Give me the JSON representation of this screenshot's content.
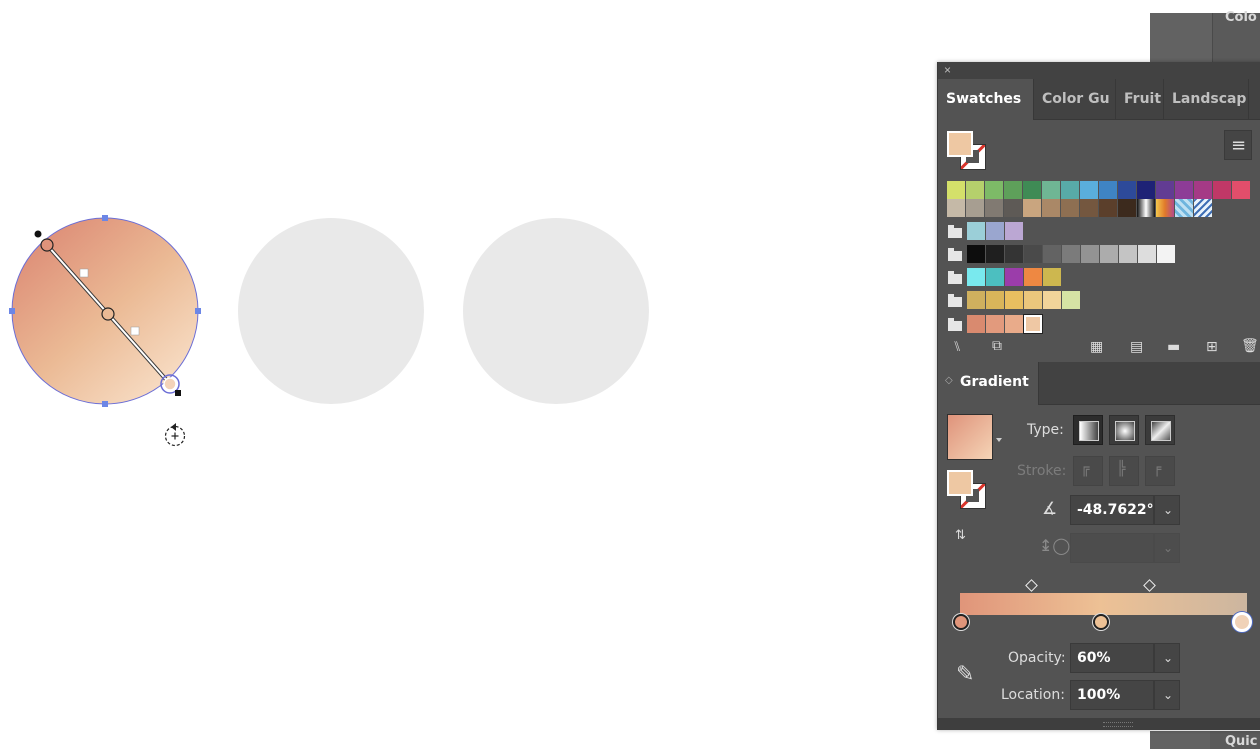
{
  "panels": {
    "color_label": "Colo",
    "quick_label": "Quic"
  },
  "swatches_panel": {
    "close_glyph": "×",
    "tabs": [
      {
        "label": "Swatches",
        "active": true
      },
      {
        "label": "Color Gu",
        "active": false
      },
      {
        "label": "Fruit",
        "active": false
      },
      {
        "label": "Landscap",
        "active": false
      }
    ],
    "menu_glyph": "≡",
    "rows": [
      [
        "#d4e06a",
        "#b5d06c",
        "#7dba67",
        "#5ea05a",
        "#3f8b55",
        "#6fb694",
        "#58aaa8",
        "#5aaedc",
        "#3f84c4",
        "#2d4a9a",
        "#1e2276",
        "#623c93",
        "#8d3c97",
        "#a53a86",
        "#c03867",
        "#e24e6b"
      ],
      [
        "#c5b9a7",
        "#a79e91",
        "#817a72",
        "#5e5a56",
        "#c9a57f",
        "#aa8867",
        "#8e6f52",
        "#74573f",
        "#5b3f2b",
        "#3c2a1d",
        "gradient-bw",
        "gradient-orange",
        "pattern-blue",
        "pattern-blue2"
      ],
      [
        "#9bcfd8",
        "#9aa6cf",
        "#bba7d3"
      ],
      [
        "#0d0d0d",
        "#1f1f1f",
        "#343434",
        "#4a4a4a",
        "#636363",
        "#7b7b7b",
        "#939393",
        "#acacac",
        "#c4c4c4",
        "#dddddd",
        "#f3f3f3"
      ],
      [
        "#79e9ee",
        "#4cbfc0",
        "#9b3daa",
        "#ee8842",
        "#cdb74f"
      ],
      [
        "#cfb05e",
        "#d9b55a",
        "#e8bf60",
        "#ebc77c",
        "#f2d49a",
        "#d6e3a4"
      ],
      [
        "#d98a6f",
        "#e29a7d",
        "#e9ab8a",
        "#efc8a4"
      ]
    ],
    "bottom_icons": [
      "library-menu-icon",
      "place-swatch-icon",
      "show-kinds-icon",
      "swatch-options-icon",
      "new-group-icon",
      "new-swatch-icon",
      "delete-icon"
    ]
  },
  "gradient_panel": {
    "title": "Gradient",
    "type_label": "Type:",
    "stroke_label": "Stroke:",
    "angle_value": "-48.7622°",
    "opacity_label": "Opacity:",
    "opacity_value": "60%",
    "location_label": "Location:",
    "location_value": "100%",
    "gradient_stops": [
      {
        "location": 0,
        "color": "#e0957a"
      },
      {
        "location": 49,
        "color": "#edc195"
      },
      {
        "location": 100,
        "color": "#f5d7b9"
      }
    ]
  },
  "canvas": {
    "colors": {
      "gradient_start": "#df937b",
      "gradient_mid": "#ebba95",
      "gradient_end": "#f7dcc3",
      "placeholder": "#e9e9e9",
      "selection": "#5b6ee1"
    }
  }
}
